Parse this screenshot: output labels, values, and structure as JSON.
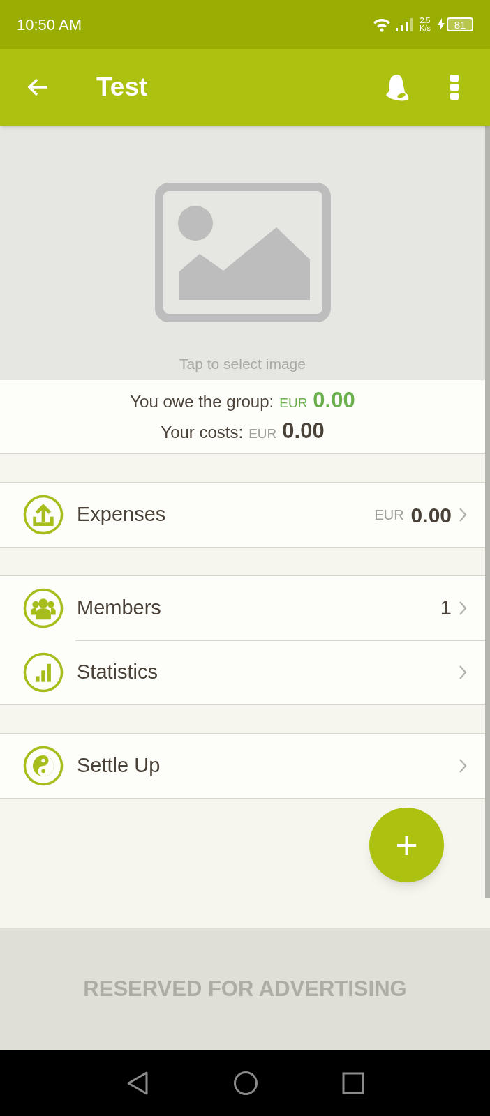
{
  "status_bar": {
    "time": "10:50 AM",
    "speed_value": "2.5",
    "speed_unit": "K/s",
    "battery": "81"
  },
  "app_bar": {
    "title": "Test"
  },
  "image_placeholder": {
    "hint": "Tap to select image"
  },
  "summary": [
    {
      "label": "You owe the group:",
      "currency": "EUR",
      "amount": "0.00",
      "color": "#6ab04c"
    },
    {
      "label": "Your costs:",
      "currency": "EUR",
      "amount": "0.00",
      "color": "#4a4238"
    }
  ],
  "sections": [
    [
      {
        "kind": "amount",
        "label": "Expenses",
        "currency": "EUR",
        "value": "0.00"
      }
    ],
    [
      {
        "kind": "count",
        "label": "Members",
        "value": "1"
      },
      {
        "kind": "plain",
        "label": "Statistics"
      }
    ],
    [
      {
        "kind": "plain",
        "label": "Settle Up"
      }
    ]
  ],
  "fab": {
    "label": "+"
  },
  "ad": {
    "text": "RESERVED FOR ADVERTISING"
  }
}
